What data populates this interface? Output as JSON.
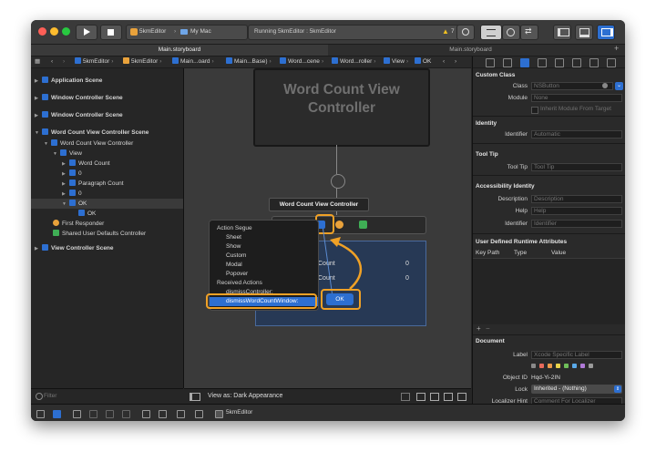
{
  "toolbar": {
    "scheme_target": "5kmEditor",
    "scheme_device": "My Mac",
    "status": "Running 5kmEditor : 5kmEditor",
    "warning_count": "7"
  },
  "tabs": [
    "Main.storyboard",
    "Main.storyboard"
  ],
  "jump_bar": [
    "5kmEditor",
    "5kmEditor",
    "Main...oard",
    "Main...Base)",
    "Word...cene",
    "Word...roller",
    "View",
    "OK"
  ],
  "navigator": {
    "rows": [
      {
        "label": "Application Scene"
      },
      {
        "label": "Window Controller Scene"
      },
      {
        "label": "Window Controller Scene"
      },
      {
        "label": "Word Count View Controller Scene"
      },
      {
        "label": "Word Count View Controller"
      },
      {
        "label": "View"
      },
      {
        "label": "Word Count"
      },
      {
        "label": "0"
      },
      {
        "label": "Paragraph Count"
      },
      {
        "label": "0"
      },
      {
        "label": "OK"
      },
      {
        "label": "OK"
      },
      {
        "label": "First Responder"
      },
      {
        "label": "Shared User Defaults Controller"
      },
      {
        "label": "View Controller Scene"
      }
    ],
    "filter_placeholder": "Filter"
  },
  "canvas": {
    "scene_title": "Word Count View Controller",
    "scene_label": "Word Count View Controller",
    "labels": [
      "Count",
      "0",
      "Count",
      "0"
    ],
    "ok_button": "OK",
    "view_as": "View as: Dark Appearance"
  },
  "popup": {
    "items": [
      "Action Segue",
      "Sheet",
      "Show",
      "Custom",
      "Modal",
      "Popover",
      "Received Actions",
      "dismissController:",
      "dismissWordCountWindow:"
    ]
  },
  "inspector": {
    "custom_class_header": "Custom Class",
    "class_label": "Class",
    "class_placeholder": "NSButton",
    "module_label": "Module",
    "module_placeholder": "None",
    "inherit_label": "Inherit Module From Target",
    "identity_header": "Identity",
    "identifier_label": "Identifier",
    "identifier_placeholder": "Automatic",
    "tooltip_header": "Tool Tip",
    "tooltip_label": "Tool Tip",
    "tooltip_placeholder": "Tool Tip",
    "accessibility_header": "Accessibility Identity",
    "description_label": "Description",
    "description_placeholder": "Description",
    "help_label": "Help",
    "help_placeholder": "Help",
    "acc_identifier_label": "Identifier",
    "acc_identifier_placeholder": "Identifier",
    "udra_header": "User Defined Runtime Attributes",
    "col_keypath": "Key Path",
    "col_type": "Type",
    "col_value": "Value",
    "document_header": "Document",
    "doc_label_label": "Label",
    "doc_label_placeholder": "Xcode Specific Label",
    "object_id_label": "Object ID",
    "object_id_value": "Hqd-Yi-2IN",
    "lock_label": "Lock",
    "lock_value": "Inherited - (Nothing)",
    "localizer_label": "Localizer Hint",
    "localizer_placeholder": "Comment For Localizer",
    "swatches": [
      "#8a8a8a",
      "#e86a5b",
      "#ee9a4a",
      "#e9d34b",
      "#6fbf5a",
      "#59a9e8",
      "#b07ad8",
      "#9a9a9a"
    ]
  },
  "bottombar": {
    "target": "5kmEditor"
  },
  "colors": {
    "accent_orange": "#f0a126",
    "selection_blue": "#2d6fd1"
  }
}
